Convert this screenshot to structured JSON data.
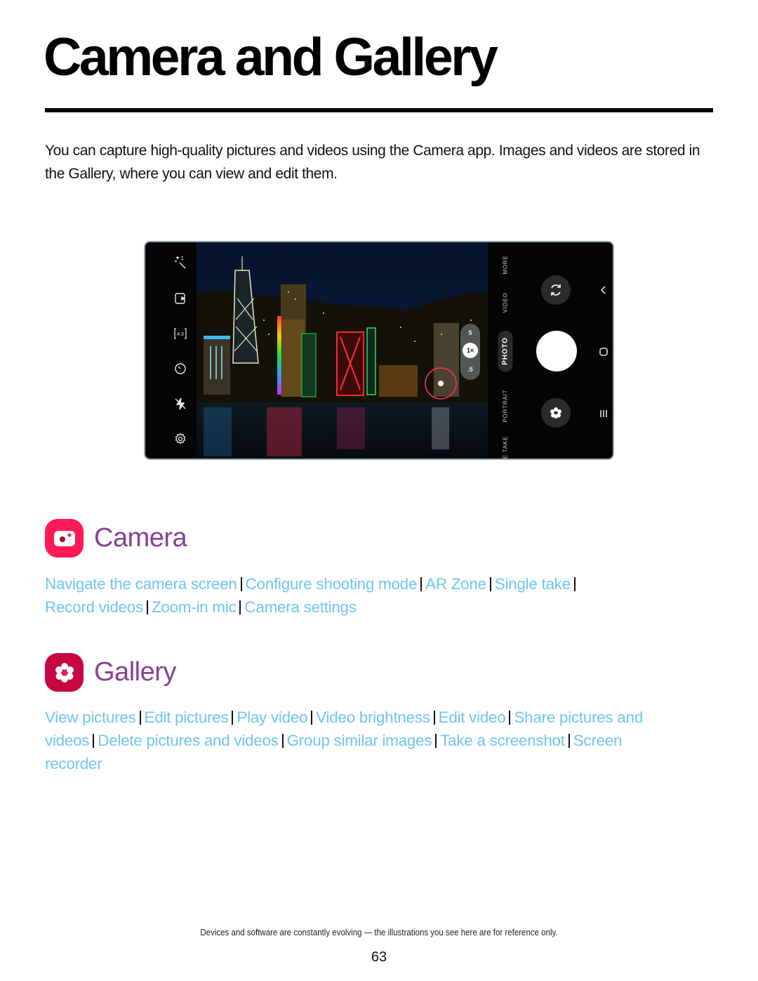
{
  "page": {
    "title": "Camera and Gallery",
    "intro": "You can capture high-quality pictures and videos using the Camera app. Images and videos are stored in the Gallery, where you can view and edit them.",
    "footnote": "Devices and software are constantly evolving — the illustrations you see here are for reference only.",
    "page_number": "63"
  },
  "phone_screenshot": {
    "left_toolbar_icons": [
      "effects-wand-icon",
      "motion-photo-icon",
      "aspect-ratio-icon",
      "timer-icon",
      "flash-off-icon",
      "settings-gear-icon"
    ],
    "aspect_ratio_label": "4:3",
    "zoom": {
      "options": [
        "5",
        "1×",
        ".5"
      ],
      "active": "1×"
    },
    "modes": [
      "MORE",
      "VIDEO",
      "PHOTO",
      "PORTRAIT",
      "E TAKE"
    ],
    "active_mode": "PHOTO",
    "controls": [
      "switch-camera-icon",
      "shutter-button",
      "gallery-thumbnail-icon"
    ],
    "nav_icons": [
      "back-icon",
      "home-icon",
      "recents-icon"
    ]
  },
  "sections": {
    "camera": {
      "title": "Camera",
      "icon_color": "#ff1a55",
      "links": [
        "Navigate the camera screen",
        "Configure shooting mode",
        "AR Zone",
        "Single take",
        "Record videos",
        "Zoom-in mic",
        "Camera settings"
      ]
    },
    "gallery": {
      "title": "Gallery",
      "icon_color": "#c8063f",
      "links": [
        "View pictures",
        "Edit pictures",
        "Play video",
        "Video brightness",
        "Edit video",
        "Share pictures and videos",
        "Delete pictures and videos",
        "Group similar images",
        "Take a screenshot",
        "Screen recorder"
      ]
    }
  },
  "colors": {
    "link": "#6ec6f1",
    "section_title": "#8a3f96"
  }
}
